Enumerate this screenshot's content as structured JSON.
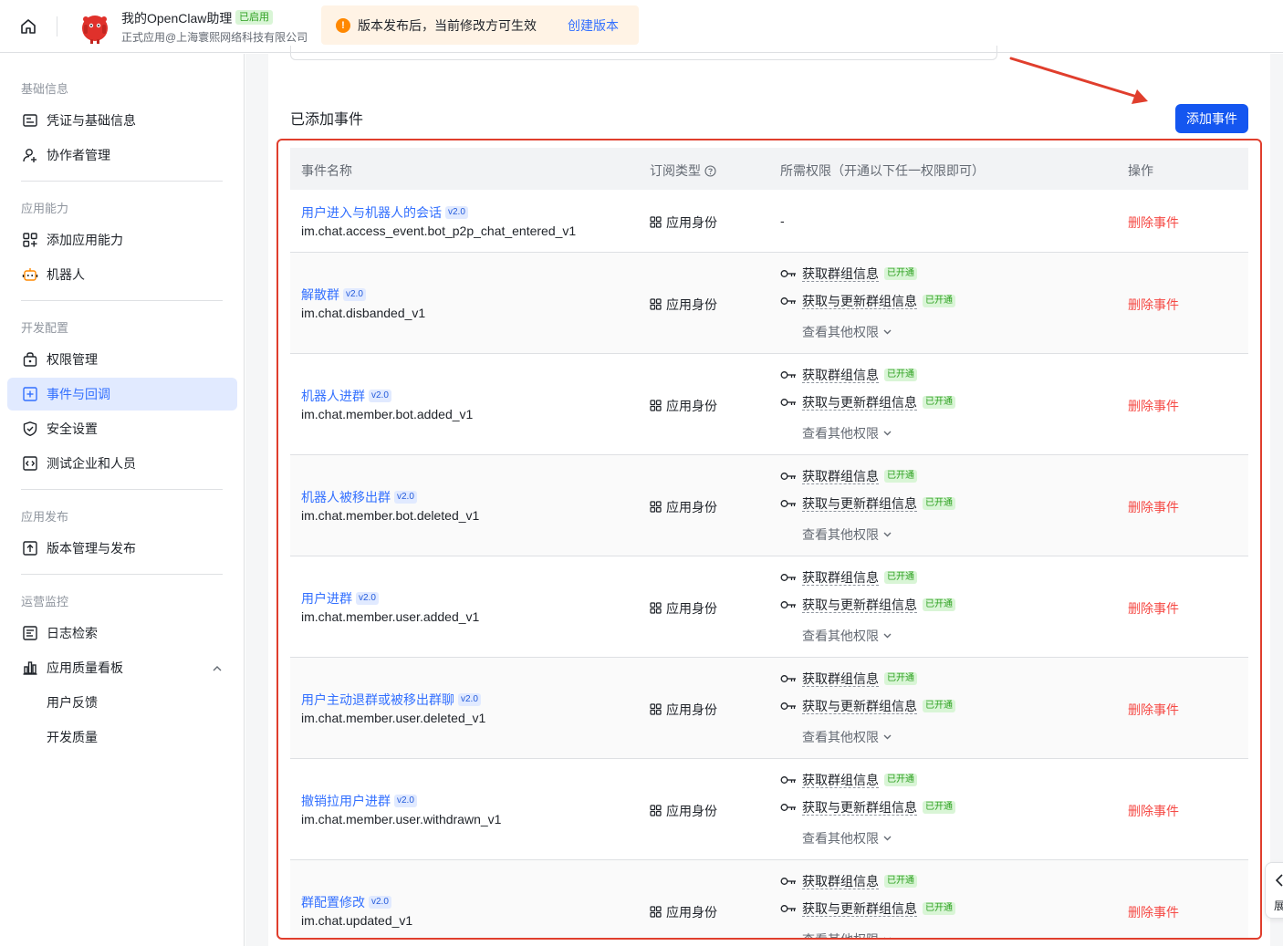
{
  "topbar": {
    "app_name": "我的OpenClaw助理",
    "app_status": "已启用",
    "company": "正式应用@上海寰熙网络科技有限公司",
    "notice_text": "版本发布后，当前修改方可生效",
    "notice_link": "创建版本",
    "notice_icon": "!"
  },
  "sidebar": {
    "groups": [
      {
        "title": "基础信息",
        "items": [
          "凭证与基础信息",
          "协作者管理"
        ]
      },
      {
        "title": "应用能力",
        "items": [
          "添加应用能力",
          "机器人"
        ]
      },
      {
        "title": "开发配置",
        "items": [
          "权限管理",
          "事件与回调",
          "安全设置",
          "测试企业和人员"
        ]
      },
      {
        "title": "应用发布",
        "items": [
          "版本管理与发布"
        ]
      },
      {
        "title": "运营监控",
        "items": [
          "日志检索",
          "应用质量看板",
          "用户反馈",
          "开发质量"
        ]
      }
    ]
  },
  "main": {
    "section_title": "已添加事件",
    "add_button": "添加事件"
  },
  "table": {
    "headers": [
      "事件名称",
      "订阅类型",
      "所需权限（开通以下任一权限即可）",
      "操作"
    ],
    "version_tag": "v2.0",
    "sub_type": "应用身份",
    "perm_1": "获取群组信息",
    "perm_2": "获取与更新群组信息",
    "perm_status": "已开通",
    "more_perm": "查看其他权限",
    "delete": "删除事件",
    "no_perm": "-",
    "rows": [
      {
        "name": "用户进入与机器人的会话",
        "code": "im.chat.access_event.bot_p2p_chat_entered_v1"
      },
      {
        "name": "解散群",
        "code": "im.chat.disbanded_v1"
      },
      {
        "name": "机器人进群",
        "code": "im.chat.member.bot.added_v1"
      },
      {
        "name": "机器人被移出群",
        "code": "im.chat.member.bot.deleted_v1"
      },
      {
        "name": "用户进群",
        "code": "im.chat.member.user.added_v1"
      },
      {
        "name": "用户主动退群或被移出群聊",
        "code": "im.chat.member.user.deleted_v1"
      },
      {
        "name": "撤销拉用户进群",
        "code": "im.chat.member.user.withdrawn_v1"
      },
      {
        "name": "群配置修改",
        "code": "im.chat.updated_v1"
      }
    ]
  },
  "float_tab": {
    "label": "展"
  },
  "colors": {
    "accent": "#3370ff",
    "primary_button": "#1456f0",
    "danger": "#f54a45",
    "highlight": "#e03e2d",
    "success": "#2ea121"
  }
}
